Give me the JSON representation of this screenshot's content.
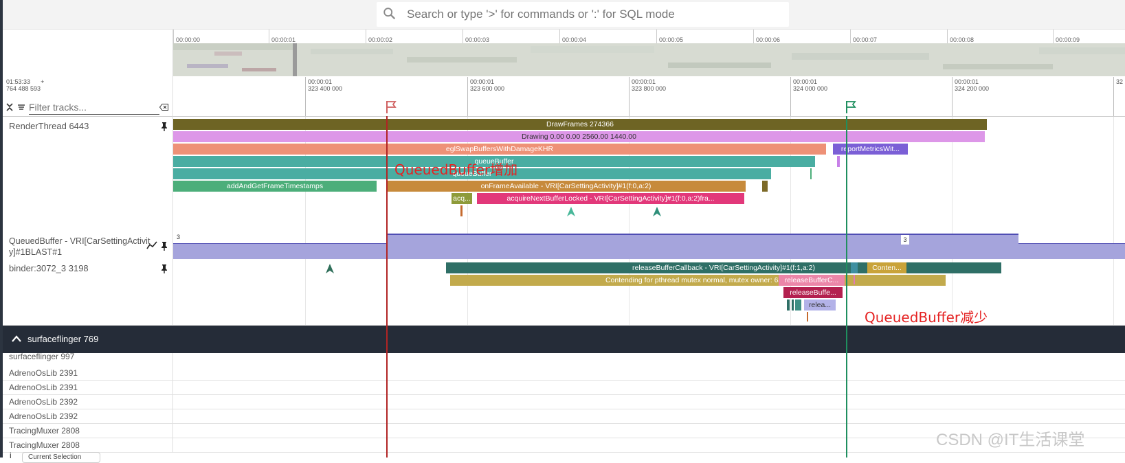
{
  "search": {
    "placeholder": "Search or type '>' for commands or ':' for SQL mode"
  },
  "overview": {
    "ticks": [
      "00:00:00",
      "00:00:01",
      "00:00:02",
      "00:00:03",
      "00:00:04",
      "00:00:05",
      "00:00:06",
      "00:00:07",
      "00:00:08",
      "00:00:09"
    ]
  },
  "timeline": {
    "base_line1": "01:53:33",
    "base_line2": "764 488 593",
    "plus": "+",
    "ticks": [
      {
        "l1": "00:00:01",
        "l2": "323 400 000"
      },
      {
        "l1": "00:00:01",
        "l2": "323 600 000"
      },
      {
        "l1": "00:00:01",
        "l2": "323 800 000"
      },
      {
        "l1": "00:00:01",
        "l2": "324 000 000"
      },
      {
        "l1": "00:00:01",
        "l2": "324 200 000"
      },
      {
        "l1": "32",
        "l2": ""
      }
    ]
  },
  "filter": {
    "placeholder": "Filter tracks..."
  },
  "tracks": {
    "render_thread": {
      "name": "RenderThread 6443",
      "slices": {
        "drawframes": "DrawFrames 274366",
        "drawing": "Drawing  0.00  0.00 2560.00 1440.00",
        "eglswap": "eglSwapBuffersWithDamageKHR",
        "report": "reportMetricsWit...",
        "queuebuffer1": "queueBuffer",
        "queuebuffer2": "queueBuffer",
        "addget": "addAndGetFrameTimestamps",
        "onframe": "onFrameAvailable - VRI[CarSettingActivity]#1(f:0,a:2)",
        "acq": "acq...",
        "acquire_next": "acquireNextBufferLocked - VRI[CarSettingActivity]#1(f:0,a:2)fra..."
      }
    },
    "queued_buffer": {
      "name_line1": "QueuedBuffer - VRI[CarSettingActivit",
      "name_line2": "y]#1BLAST#1",
      "value_left": "3",
      "value_mid": "3"
    },
    "binder": {
      "name": "binder:3072_3 3198",
      "slices": {
        "release_cb": "releaseBufferCallback - VRI[CarSettingActivity]#1(f:1,a:2)",
        "conten_short": "Conten...",
        "contending": "Contending for pthread mutex normal, mutex owner: 6443",
        "release_c": "releaseBufferC...",
        "release_buffe": "releaseBuffe...",
        "relea": "relea..."
      }
    }
  },
  "surfaceflinger": {
    "title": "surfaceflinger 769",
    "rows": [
      "surfaceflinger 997",
      "AdrenoOsLib 2391",
      "AdrenoOsLib 2391",
      "AdrenoOsLib 2392",
      "AdrenoOsLib 2392",
      "TracingMuxer 2808",
      "TracingMuxer 2808"
    ]
  },
  "annotations": {
    "increase": "QueuedBuffer增加",
    "decrease": "QueuedBuffer减少"
  },
  "watermark": "CSDN @IT生活课堂",
  "bottom": {
    "button": "Current Selection",
    "dot": "i"
  },
  "colors": {
    "red_marker": "#b12424",
    "green_marker": "#1f8f5f",
    "drawframes": "#6e6424",
    "drawing": "#dd97e8",
    "eglswap": "#ee9177",
    "teal": "#4aada2",
    "green_slice": "#4cae7a",
    "onframe": "#c78a3b",
    "pink": "#e2387a",
    "counter": "#a5a4dc"
  }
}
